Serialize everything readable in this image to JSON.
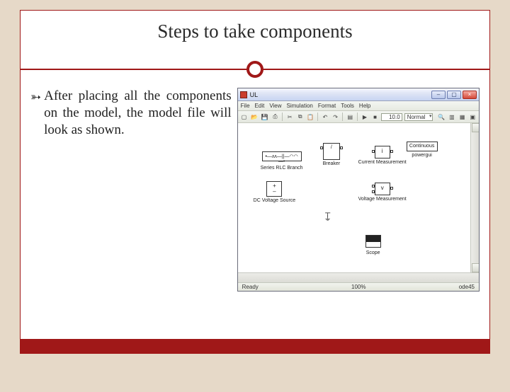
{
  "slide": {
    "title": "Steps to take components",
    "bullet_text": "After placing all the components on the model, the model file will look as shown."
  },
  "window": {
    "title": "UL",
    "menu": [
      "File",
      "Edit",
      "View",
      "Simulation",
      "Format",
      "Tools",
      "Help"
    ],
    "toolbar": {
      "sim_stop_time": "10.0",
      "mode": "Normal"
    },
    "status": {
      "left": "Ready",
      "mid": "100%",
      "right": "ode45"
    },
    "blocks": {
      "rlc": "Series RLC Branch",
      "breaker": "Breaker",
      "currmeas": "Current Measurement",
      "continuous": "Continuous",
      "powergui": "powergui",
      "dcsrc": "DC Voltage Source",
      "voltmeas": "Voltage Measurement",
      "ground": "",
      "scope": "Scope"
    }
  }
}
